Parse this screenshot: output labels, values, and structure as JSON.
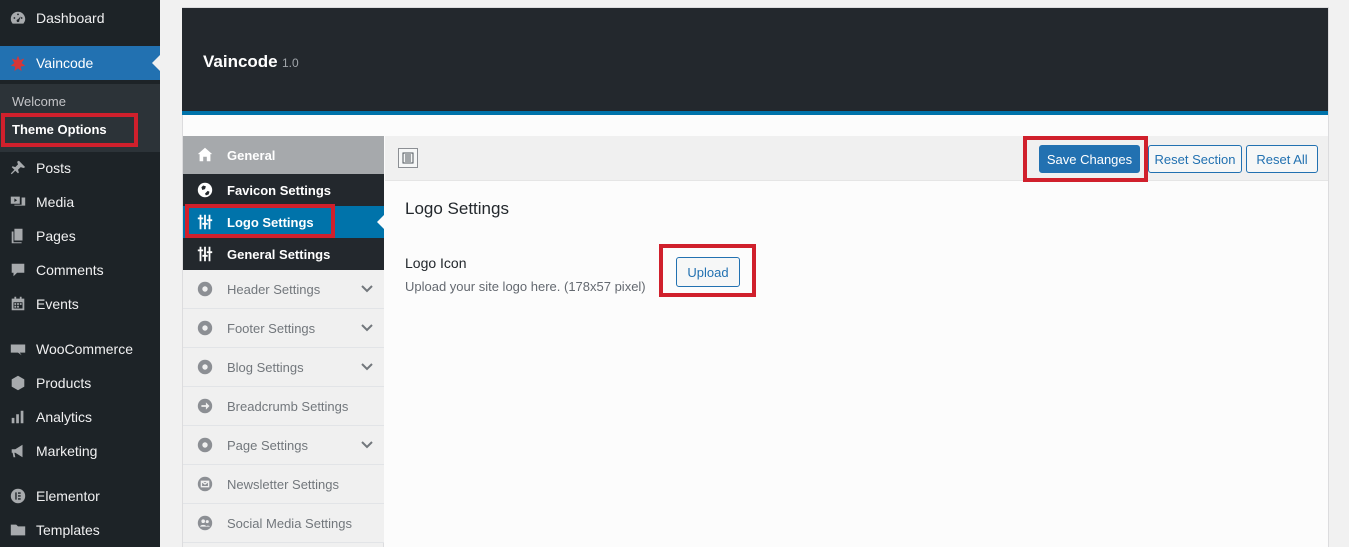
{
  "wp_menu": {
    "dashboard": "Dashboard",
    "vaincode": "Vaincode",
    "submenu": {
      "welcome": "Welcome",
      "theme_options": "Theme Options"
    },
    "posts": "Posts",
    "media": "Media",
    "pages": "Pages",
    "comments": "Comments",
    "events": "Events",
    "woocommerce": "WooCommerce",
    "products": "Products",
    "analytics": "Analytics",
    "marketing": "Marketing",
    "elementor": "Elementor",
    "templates": "Templates"
  },
  "panel": {
    "title": "Vaincode",
    "version": "1.0"
  },
  "sections": {
    "general": "General",
    "favicon": "Favicon Settings",
    "logo": "Logo Settings",
    "general_settings": "General Settings",
    "header": "Header Settings",
    "footer": "Footer Settings",
    "blog": "Blog Settings",
    "breadcrumb": "Breadcrumb Settings",
    "page": "Page Settings",
    "newsletter": "Newsletter Settings",
    "social": "Social Media Settings"
  },
  "toolbar": {
    "save": "Save Changes",
    "reset_section": "Reset Section",
    "reset_all": "Reset All"
  },
  "content": {
    "section_title": "Logo Settings",
    "field_label": "Logo Icon",
    "field_desc": "Upload your site logo here. (178x57 pixel)",
    "upload": "Upload"
  },
  "colors": {
    "accent": "#2271b1",
    "highlight": "#d0202c",
    "sidebar": "#1d2327"
  }
}
